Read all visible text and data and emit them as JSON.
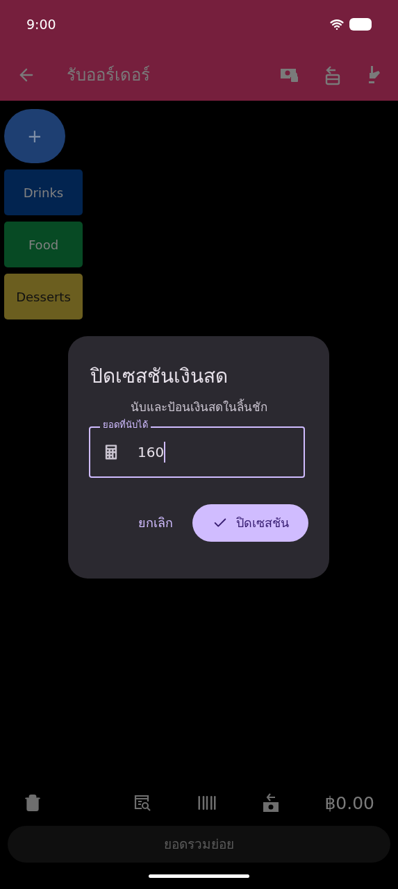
{
  "status_bar": {
    "time": "9:00"
  },
  "app_bar": {
    "title": "รับออร์เดอร์"
  },
  "add_button": {
    "label": "+"
  },
  "categories": [
    {
      "label": "Drinks",
      "color": "#022450"
    },
    {
      "label": "Food",
      "color": "#074a24"
    },
    {
      "label": "Desserts",
      "color": "#6b5e1f"
    }
  ],
  "dialog": {
    "title": "ปิดเซสชันเงินสด",
    "message": "นับและป้อนเงินสดในลิ้นชัก",
    "field": {
      "label": "ยอดที่นับได้",
      "value": "160"
    },
    "cancel": "ยกเลิก",
    "confirm": "ปิดเซสชัน"
  },
  "bottom_bar": {
    "total": "฿0.00",
    "subtotal_button": "ยอดรวมย่อย"
  }
}
